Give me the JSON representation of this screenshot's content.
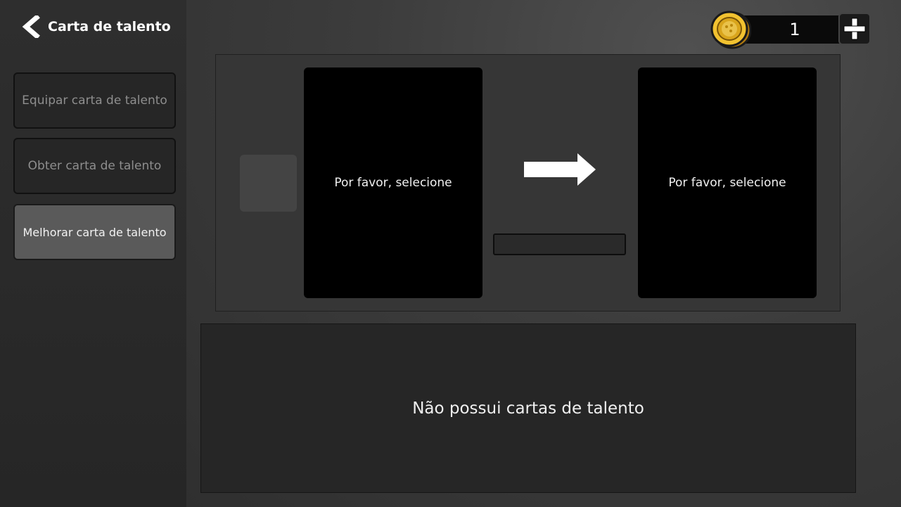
{
  "header": {
    "title": "Carta de talento",
    "back_icon": "chevron-left-icon"
  },
  "sidebar": {
    "tabs": [
      {
        "label": "Equipar carta de talento",
        "active": false
      },
      {
        "label": "Obter carta de talento",
        "active": false
      },
      {
        "label": "Melhorar carta de talento",
        "active": true
      }
    ]
  },
  "currency": {
    "amount": "1",
    "icon": "gold-coin-icon",
    "add_icon": "plus-icon"
  },
  "upgrade": {
    "source_card_label": "Por favor, selecione",
    "target_card_label": "Por favor, selecione",
    "arrow_icon": "arrow-right-icon",
    "progress": 0
  },
  "inventory": {
    "empty_message": "Não possui cartas de talento"
  },
  "colors": {
    "accent_gold": "#f2c230",
    "panel": "#363636",
    "card": "#000000"
  }
}
